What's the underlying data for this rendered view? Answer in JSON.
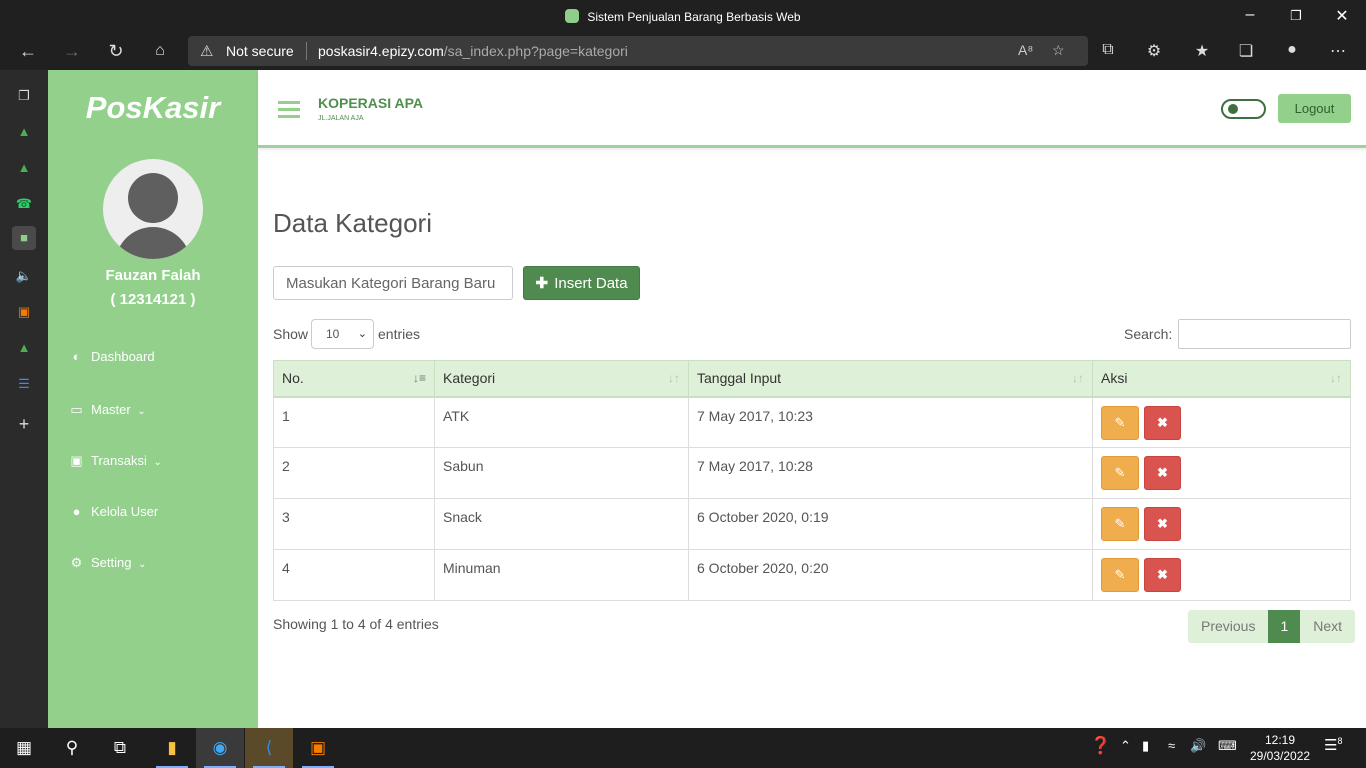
{
  "window": {
    "title": "Sistem Penjualan Barang Berbasis Web"
  },
  "browser": {
    "security_label": "Not secure",
    "url_host": "poskasir4.epizy.com",
    "url_path": "/sa_index.php?page=kategori"
  },
  "sidebar": {
    "logo": "PosKasir",
    "user_name": "Fauzan Falah",
    "user_id": "( 12314121 )",
    "menu": [
      {
        "label": "Dashboard",
        "icon": "dashboard-icon"
      },
      {
        "label": "Master",
        "icon": "monitor-icon"
      },
      {
        "label": "Transaksi",
        "icon": "money-icon"
      },
      {
        "label": "Kelola User",
        "icon": "user-icon"
      },
      {
        "label": "Setting",
        "icon": "gear-icon"
      }
    ]
  },
  "header": {
    "org_name": "KOPERASI APA",
    "org_address": "JL.JALAN AJA",
    "logout_label": "Logout"
  },
  "main": {
    "title": "Data Kategori",
    "category_placeholder": "Masukan Kategori Barang Baru",
    "insert_label": "Insert Data",
    "show_label": "Show",
    "page_length": "10",
    "entries_label": "entries",
    "search_label": "Search:",
    "table": {
      "headers": [
        "No.",
        "Kategori",
        "Tanggal Input",
        "Aksi"
      ],
      "rows": [
        {
          "no": "1",
          "kategori": "ATK",
          "tanggal": "7 May 2017, 10:23"
        },
        {
          "no": "2",
          "kategori": "Sabun",
          "tanggal": "7 May 2017, 10:28"
        },
        {
          "no": "3",
          "kategori": "Snack",
          "tanggal": "6 October 2020, 0:19"
        },
        {
          "no": "4",
          "kategori": "Minuman",
          "tanggal": "6 October 2020, 0:20"
        }
      ]
    },
    "info": "Showing 1 to 4 of 4 entries",
    "pagination": {
      "previous": "Previous",
      "current": "1",
      "next": "Next"
    }
  },
  "taskbar": {
    "time": "12:19",
    "date": "29/03/2022",
    "notification_count": "8"
  },
  "colors": {
    "sidebar": "#92d08c",
    "accent": "#4f8a4f",
    "edit": "#f0ad4e",
    "delete": "#d9534f",
    "table_header": "#dff0d8"
  }
}
